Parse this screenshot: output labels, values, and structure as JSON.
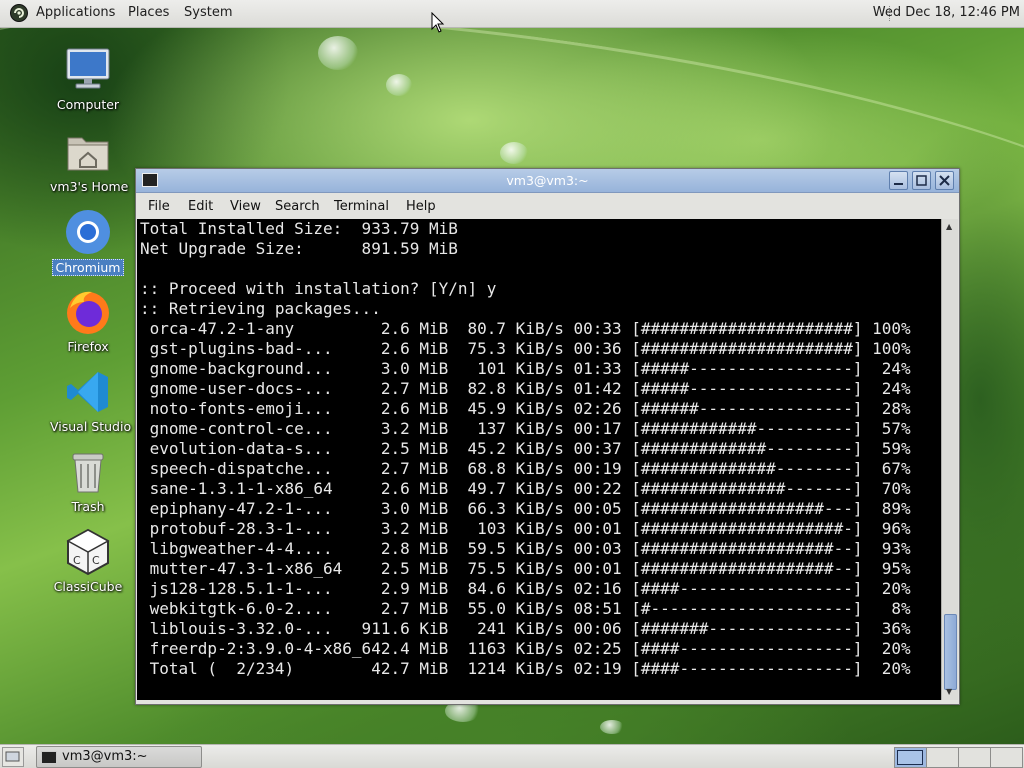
{
  "top_panel": {
    "menus": [
      "Applications",
      "Places",
      "System"
    ],
    "clock": "Wed Dec 18, 12:46 PM"
  },
  "desktop_icons": [
    {
      "label": "Computer",
      "icon": "computer-icon"
    },
    {
      "label": "vm3's Home",
      "icon": "home-folder-icon"
    },
    {
      "label": "Chromium",
      "icon": "chromium-icon"
    },
    {
      "label": "Firefox",
      "icon": "firefox-icon"
    },
    {
      "label": "Visual Studio Code",
      "icon": "vscode-icon"
    },
    {
      "label": "Trash",
      "icon": "trash-icon"
    },
    {
      "label": "ClassiCube",
      "icon": "classicube-icon"
    }
  ],
  "terminal": {
    "title": "vm3@vm3:~",
    "menu": [
      "File",
      "Edit",
      "View",
      "Search",
      "Terminal",
      "Help"
    ],
    "lines": [
      "Total Installed Size:  933.79 MiB",
      "Net Upgrade Size:      891.59 MiB",
      "",
      ":: Proceed with installation? [Y/n] y",
      ":: Retrieving packages...",
      " orca-47.2-1-any         2.6 MiB  80.7 KiB/s 00:33 [######################] 100%",
      " gst-plugins-bad-...     2.6 MiB  75.3 KiB/s 00:36 [######################] 100%",
      " gnome-background...     3.0 MiB   101 KiB/s 01:33 [#####-----------------]  24%",
      " gnome-user-docs-...     2.7 MiB  82.8 KiB/s 01:42 [#####-----------------]  24%",
      " noto-fonts-emoji...     2.6 MiB  45.9 KiB/s 02:26 [######----------------]  28%",
      " gnome-control-ce...     3.2 MiB   137 KiB/s 00:17 [############----------]  57%",
      " evolution-data-s...     2.5 MiB  45.2 KiB/s 00:37 [#############---------]  59%",
      " speech-dispatche...     2.7 MiB  68.8 KiB/s 00:19 [##############--------]  67%",
      " sane-1.3.1-1-x86_64     2.6 MiB  49.7 KiB/s 00:22 [###############-------]  70%",
      " epiphany-47.2-1-...     3.0 MiB  66.3 KiB/s 00:05 [###################---]  89%",
      " protobuf-28.3-1-...     3.2 MiB   103 KiB/s 00:01 [#####################-]  96%",
      " libgweather-4-4....     2.8 MiB  59.5 KiB/s 00:03 [####################--]  93%",
      " mutter-47.3-1-x86_64    2.5 MiB  75.5 KiB/s 00:01 [####################--]  95%",
      " js128-128.5.1-1-...     2.9 MiB  84.6 KiB/s 02:16 [####------------------]  20%",
      " webkitgtk-6.0-2....     2.7 MiB  55.0 KiB/s 08:51 [#---------------------]   8%",
      " liblouis-3.32.0-...   911.6 KiB   241 KiB/s 00:06 [#######---------------]  36%",
      " freerdp-2:3.9.0-4-x86_642.4 MiB  1163 KiB/s 02:25 [####------------------]  20%",
      " Total (  2/234)        42.7 MiB  1214 KiB/s 02:19 [####------------------]  20%"
    ]
  },
  "taskbar": {
    "task_label": "vm3@vm3:~"
  }
}
